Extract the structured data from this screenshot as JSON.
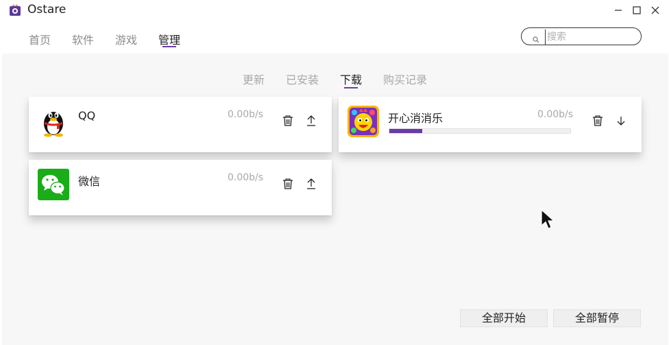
{
  "app": {
    "title": "Ostare",
    "logo_icon": "ostare-logo-icon"
  },
  "window_controls": {
    "minimize": "minimize-icon",
    "maximize": "maximize-icon",
    "close": "close-icon"
  },
  "nav": {
    "items": [
      {
        "label": "首页",
        "active": false
      },
      {
        "label": "软件",
        "active": false
      },
      {
        "label": "游戏",
        "active": false
      },
      {
        "label": "管理",
        "active": true
      }
    ]
  },
  "search": {
    "placeholder": "搜索",
    "value": ""
  },
  "subtabs": {
    "items": [
      {
        "label": "更新",
        "active": false
      },
      {
        "label": "已安装",
        "active": false
      },
      {
        "label": "下载",
        "active": true
      },
      {
        "label": "购买记录",
        "active": false
      }
    ]
  },
  "downloads": [
    {
      "name": "QQ",
      "speed": "0.00b/s",
      "icon": "qq-penguin-icon",
      "actions": [
        "trash-icon",
        "upload-icon"
      ]
    },
    {
      "name": "开心消消乐",
      "speed": "0.00b/s",
      "icon": "kaixin-xiaoxiaole-game-icon",
      "progress": 0.18,
      "actions": [
        "trash-icon",
        "download-icon"
      ]
    },
    {
      "name": "微信",
      "speed": "0.00b/s",
      "icon": "wechat-icon",
      "actions": [
        "trash-icon",
        "upload-icon"
      ]
    }
  ],
  "footer": {
    "start_all": "全部开始",
    "pause_all": "全部暂停"
  },
  "colors": {
    "accent": "#6a3aa8",
    "wechat_green": "#1aad19",
    "background": "#f7f7f7"
  }
}
